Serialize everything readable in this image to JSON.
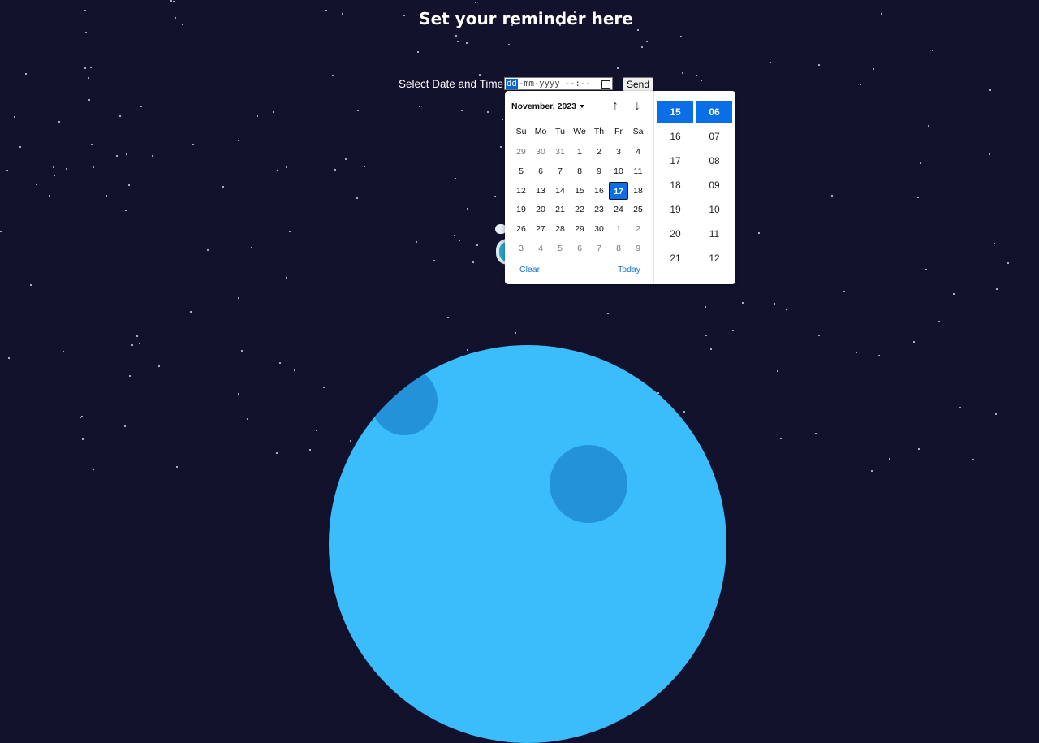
{
  "page": {
    "title": "Set your reminder here"
  },
  "form": {
    "label": "Select Date and Time:",
    "input_day_segment": "dd",
    "input_rest": "-mm-yyyy --:--",
    "send_label": "Send"
  },
  "picker": {
    "month_label": "November, 2023",
    "weekdays": [
      "Su",
      "Mo",
      "Tu",
      "We",
      "Th",
      "Fr",
      "Sa"
    ],
    "weeks": [
      [
        "29",
        "30",
        "31",
        "1",
        "2",
        "3",
        "4"
      ],
      [
        "5",
        "6",
        "7",
        "8",
        "9",
        "10",
        "11"
      ],
      [
        "12",
        "13",
        "14",
        "15",
        "16",
        "17",
        "18"
      ],
      [
        "19",
        "20",
        "21",
        "22",
        "23",
        "24",
        "25"
      ],
      [
        "26",
        "27",
        "28",
        "29",
        "30",
        "1",
        "2"
      ],
      [
        "3",
        "4",
        "5",
        "6",
        "7",
        "8",
        "9"
      ]
    ],
    "muted": [
      [
        0,
        0
      ],
      [
        0,
        1
      ],
      [
        0,
        2
      ],
      [
        4,
        5
      ],
      [
        4,
        6
      ],
      [
        5,
        0
      ],
      [
        5,
        1
      ],
      [
        5,
        2
      ],
      [
        5,
        3
      ],
      [
        5,
        4
      ],
      [
        5,
        5
      ],
      [
        5,
        6
      ]
    ],
    "selected_day": "17",
    "clear_label": "Clear",
    "today_label": "Today",
    "hours": [
      "15",
      "16",
      "17",
      "18",
      "19",
      "20",
      "21"
    ],
    "minutes": [
      "06",
      "07",
      "08",
      "09",
      "10",
      "11",
      "12"
    ],
    "selected_hour": "15",
    "selected_minute": "06"
  },
  "colors": {
    "background": "#12122d",
    "accent": "#0a6ee6",
    "planet": "#3bbcfb",
    "crater": "#2392d8"
  }
}
